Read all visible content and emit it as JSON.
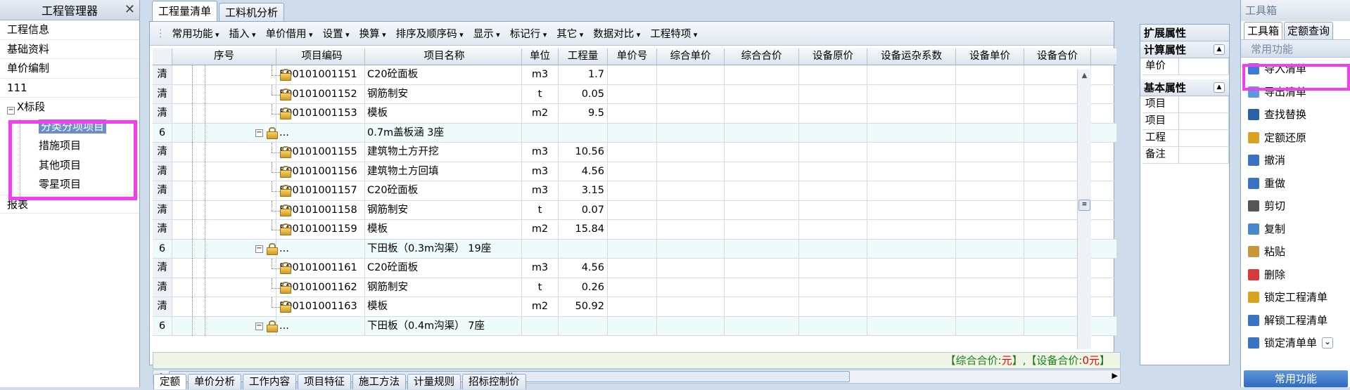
{
  "left_panel": {
    "title": "工程管理器",
    "items": [
      "工程信息",
      "基础资料",
      "单价编制",
      "111"
    ],
    "tree_root": "X标段",
    "tree_children": [
      "分类分项项目",
      "措施项目",
      "其他项目",
      "零星项目"
    ],
    "bottom_item": "报表"
  },
  "center": {
    "tabs": [
      "工程量清单",
      "工料机分析"
    ],
    "toolbar": [
      "常用功能",
      "插入",
      "单价借用",
      "设置",
      "换算",
      "排序及顺序码",
      "显示",
      "标记行",
      "其它",
      "数据对比",
      "工程特项"
    ],
    "columns": [
      "序号",
      "项目编码",
      "项目名称",
      "单位",
      "工程量",
      "单价号",
      "综合单价",
      "综合合价",
      "设备原价",
      "设备运杂系数",
      "设备单价",
      "设备合价"
    ],
    "rows": [
      {
        "seq": "清",
        "code": "500101001151",
        "name": "C20砼面板",
        "unit": "m3",
        "qty": "1.7"
      },
      {
        "seq": "清",
        "code": "500101001152",
        "name": "钢筋制安",
        "unit": "t",
        "qty": "0.05"
      },
      {
        "seq": "清",
        "code": "500101001153",
        "name": "模板",
        "unit": "m2",
        "qty": "9.5"
      },
      {
        "seq": "6",
        "code": "",
        "name": "0.7m盖板涵 3座",
        "unit": "",
        "qty": "",
        "group": true
      },
      {
        "seq": "清",
        "code": "500101001155",
        "name": "建筑物土方开挖",
        "unit": "m3",
        "qty": "10.56"
      },
      {
        "seq": "清",
        "code": "500101001156",
        "name": "建筑物土方回填",
        "unit": "m3",
        "qty": "4.56"
      },
      {
        "seq": "清",
        "code": "500101001157",
        "name": "C20砼面板",
        "unit": "m3",
        "qty": "3.15"
      },
      {
        "seq": "清",
        "code": "500101001158",
        "name": "钢筋制安",
        "unit": "t",
        "qty": "0.07"
      },
      {
        "seq": "清",
        "code": "500101001159",
        "name": "模板",
        "unit": "m2",
        "qty": "15.84"
      },
      {
        "seq": "6",
        "code": "",
        "name": "下田板（0.3m沟渠） 19座",
        "unit": "",
        "qty": "",
        "group": true
      },
      {
        "seq": "清",
        "code": "500101001161",
        "name": "C20砼面板",
        "unit": "m3",
        "qty": "4.56"
      },
      {
        "seq": "清",
        "code": "500101001162",
        "name": "钢筋制安",
        "unit": "t",
        "qty": "0.26"
      },
      {
        "seq": "清",
        "code": "500101001163",
        "name": "模板",
        "unit": "m2",
        "qty": "50.92"
      },
      {
        "seq": "6",
        "code": "",
        "name": "下田板（0.4m沟渠） 7座",
        "unit": "",
        "qty": "",
        "group": true
      }
    ],
    "group_dots": "...",
    "status": {
      "prefix": "【综合合价:",
      "val1": "元",
      "mid": "】,【设备合价:",
      "val2": "0元",
      "suffix": "】"
    },
    "bottom_tabs": [
      "定额",
      "单价分析",
      "工作内容",
      "项目特征",
      "施工方法",
      "计量规则",
      "招标控制价"
    ]
  },
  "ext_panel": {
    "title": "扩展属性",
    "calc_title": "计算属性",
    "calc_rows": [
      "单价"
    ],
    "basic_title": "基本属性",
    "basic_rows": [
      "项目",
      "项目",
      "工程",
      "备注"
    ]
  },
  "toolbox": {
    "title": "工具箱",
    "tabs": [
      "工具箱",
      "定额查询"
    ],
    "section": "常用功能",
    "items": [
      {
        "label": "导入清单",
        "icon": "import-list-icon",
        "color": "#3d7bd6"
      },
      {
        "label": "导出清单",
        "icon": "export-list-icon",
        "color": "#5a9be0"
      },
      {
        "label": "查找替换",
        "icon": "binoculars-icon",
        "color": "#2a5faa"
      },
      {
        "label": "定额还原",
        "icon": "restore-icon",
        "color": "#d9a320"
      },
      {
        "label": "撤消",
        "icon": "undo-icon",
        "color": "#3a72c4"
      },
      {
        "label": "重做",
        "icon": "redo-icon",
        "color": "#3a72c4"
      },
      {
        "label": "剪切",
        "icon": "scissors-icon",
        "color": "#555555"
      },
      {
        "label": "复制",
        "icon": "copy-icon",
        "color": "#4a86d0"
      },
      {
        "label": "粘贴",
        "icon": "paste-icon",
        "color": "#c9963a"
      },
      {
        "label": "删除",
        "icon": "delete-icon",
        "color": "#d83a3a"
      },
      {
        "label": "锁定工程清单",
        "icon": "lock-icon",
        "color": "#d9a320"
      },
      {
        "label": "解锁工程清单",
        "icon": "unlock-icon",
        "color": "#3a72c4"
      },
      {
        "label": "锁定清单单",
        "icon": "lock-list-icon",
        "color": "#3a72c4"
      }
    ],
    "footer": "常用功能"
  }
}
